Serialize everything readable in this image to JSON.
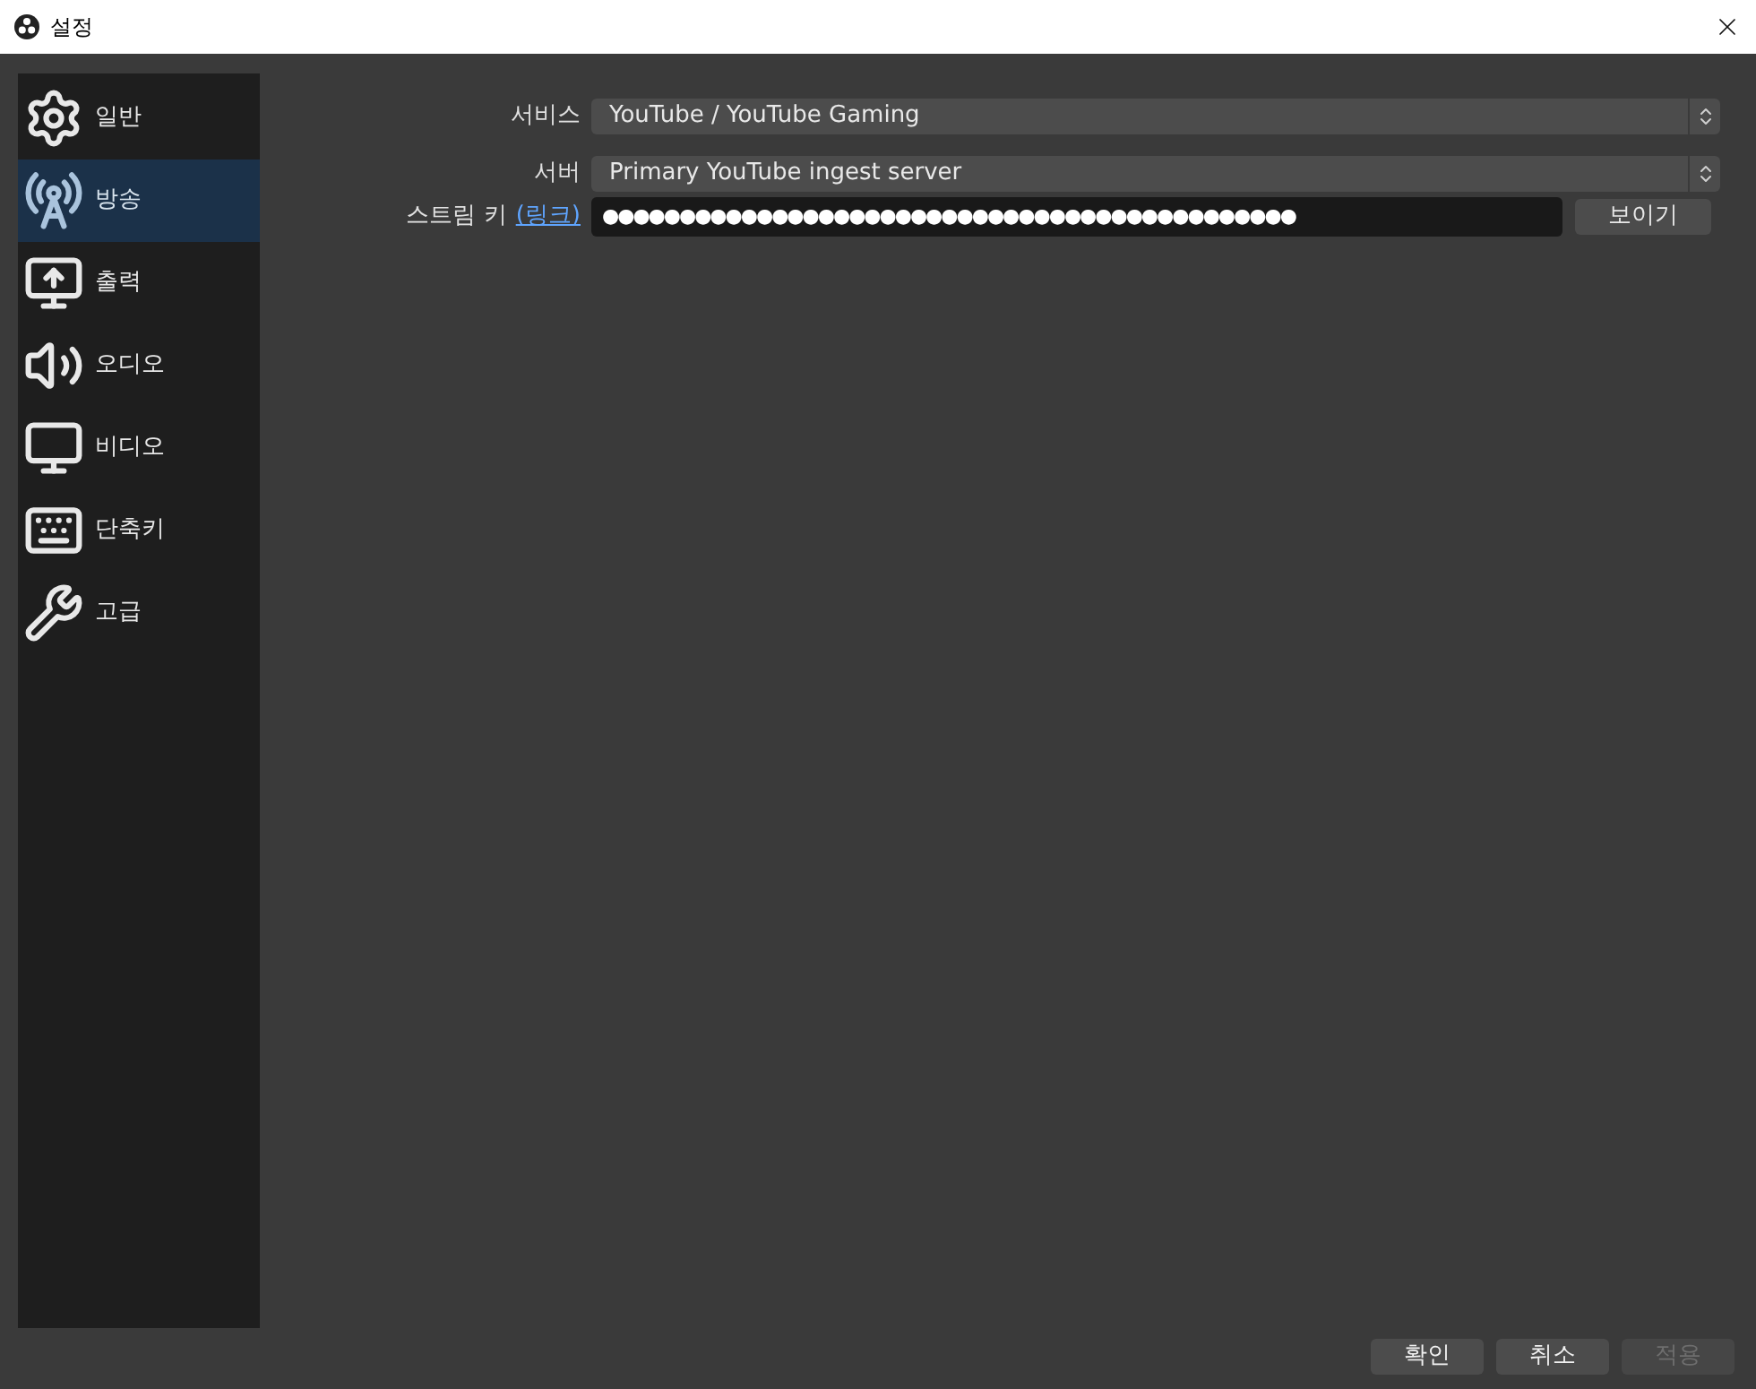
{
  "window": {
    "title": "설정"
  },
  "sidebar": {
    "items": [
      {
        "kind": "general",
        "label": "일반",
        "selected": false
      },
      {
        "kind": "stream",
        "label": "방송",
        "selected": true
      },
      {
        "kind": "output",
        "label": "출력",
        "selected": false
      },
      {
        "kind": "audio",
        "label": "오디오",
        "selected": false
      },
      {
        "kind": "video",
        "label": "비디오",
        "selected": false
      },
      {
        "kind": "hotkeys",
        "label": "단축키",
        "selected": false
      },
      {
        "kind": "advanced",
        "label": "고급",
        "selected": false
      }
    ]
  },
  "form": {
    "service": {
      "label": "서비스",
      "value": "YouTube / YouTube Gaming"
    },
    "server": {
      "label": "서버",
      "value": "Primary YouTube ingest server"
    },
    "stream_key": {
      "label": "스트림 키",
      "link": "(링크)",
      "value": "●●●●●●●●●●●●●●●●●●●●●●●●●●●●●●●●●●●●●●●●●●●●●",
      "show_button": "보이기"
    }
  },
  "buttons": [
    {
      "label": "확인",
      "disabled": false
    },
    {
      "label": "취소",
      "disabled": false
    },
    {
      "label": "적용",
      "disabled": true
    }
  ]
}
